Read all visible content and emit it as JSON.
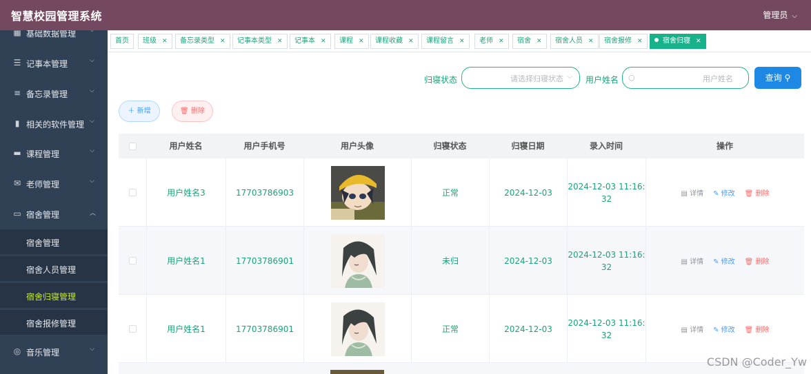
{
  "header": {
    "title": "智慧校园管理系统",
    "user": "管理员"
  },
  "sidebar": {
    "items": [
      {
        "label": "基础数据管理",
        "icon": "grid-icon"
      },
      {
        "label": "记事本管理",
        "icon": "sliders-icon"
      },
      {
        "label": "备忘录管理",
        "icon": "list-icon"
      },
      {
        "label": "相关的软件管理",
        "icon": "bar-chart-icon"
      },
      {
        "label": "课程管理",
        "icon": "box-icon"
      },
      {
        "label": "老师管理",
        "icon": "mail-icon"
      },
      {
        "label": "宿舍管理",
        "icon": "chat-icon"
      },
      {
        "label": "音乐管理",
        "icon": "compass-icon"
      }
    ],
    "submenu": [
      {
        "label": "宿舍管理"
      },
      {
        "label": "宿舍人员管理"
      },
      {
        "label": "宿舍归寝管理"
      },
      {
        "label": "宿舍报修管理"
      }
    ]
  },
  "tags": [
    "首页",
    "班级",
    "备忘录类型",
    "记事本类型",
    "记事本",
    "课程",
    "课程收藏",
    "课程留言",
    "老师",
    "宿舍",
    "宿舍人员",
    "宿舍报修",
    "宿舍归寝"
  ],
  "search": {
    "status_label": "归寝状态",
    "status_placeholder": "请选择归寝状态",
    "name_label": "用户姓名",
    "name_placeholder": "用户姓名",
    "query_label": "查询"
  },
  "actions": {
    "add_label": "＋ 新增",
    "delete_label": "删除"
  },
  "table": {
    "columns": [
      "用户姓名",
      "用户手机号",
      "用户头像",
      "归寝状态",
      "归寝日期",
      "录入时间",
      "操作"
    ],
    "rows": [
      {
        "name": "用户姓名3",
        "phone": "17703786903",
        "status": "正常",
        "date": "2024-12-03",
        "created_l1": "2024-12-03 11:16:",
        "created_l2": "32",
        "avatar": "avatar-yellow-hat-boy"
      },
      {
        "name": "用户姓名1",
        "phone": "17703786901",
        "status": "未归",
        "date": "2024-12-03",
        "created_l1": "2024-12-03 11:16:",
        "created_l2": "32",
        "avatar": "avatar-dark-hair-girl"
      },
      {
        "name": "用户姓名1",
        "phone": "17703786901",
        "status": "正常",
        "date": "2024-12-03",
        "created_l1": "2024-12-03 11:16:",
        "created_l2": "32",
        "avatar": "avatar-dark-hair-girl"
      }
    ],
    "ops": {
      "detail": "详情",
      "edit": "修改",
      "delete": "删除"
    }
  },
  "watermark": "CSDN @Coder_Yw",
  "colors": {
    "header": "#74485e",
    "sidebar": "#304156",
    "accent": "#1aa37a",
    "active_menu": "#c5e63a",
    "query": "#1e88e5"
  }
}
